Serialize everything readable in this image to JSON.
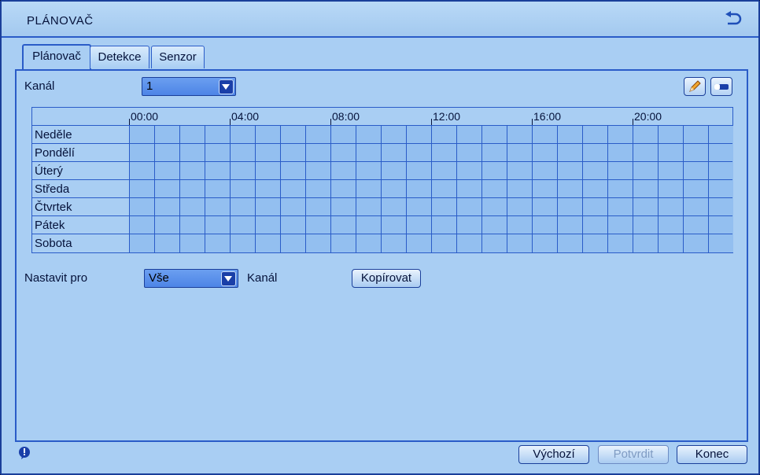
{
  "window": {
    "title": "PLÁNOVAČ"
  },
  "tabs": [
    {
      "label": "Plánovač",
      "active": true
    },
    {
      "label": "Detekce",
      "active": false
    },
    {
      "label": "Senzor",
      "active": false
    }
  ],
  "channel": {
    "label": "Kanál",
    "value": "1"
  },
  "toolbar": {
    "edit_icon": "pencil-icon",
    "erase_icon": "eraser-icon"
  },
  "schedule": {
    "hours": [
      "00:00",
      "04:00",
      "08:00",
      "12:00",
      "16:00",
      "20:00"
    ],
    "days": [
      "Neděle",
      "Pondělí",
      "Úterý",
      "Středa",
      "Čtvrtek",
      "Pátek",
      "Sobota"
    ]
  },
  "apply": {
    "label": "Nastavit pro",
    "value": "Vše",
    "suffix": "Kanál",
    "copy_label": "Kopírovat"
  },
  "footer": {
    "default_label": "Výchozí",
    "confirm_label": "Potvrdit",
    "exit_label": "Konec"
  },
  "colors": {
    "accent": "#2a5cc8",
    "background": "#a9cef3",
    "cell": "#93bff0"
  }
}
